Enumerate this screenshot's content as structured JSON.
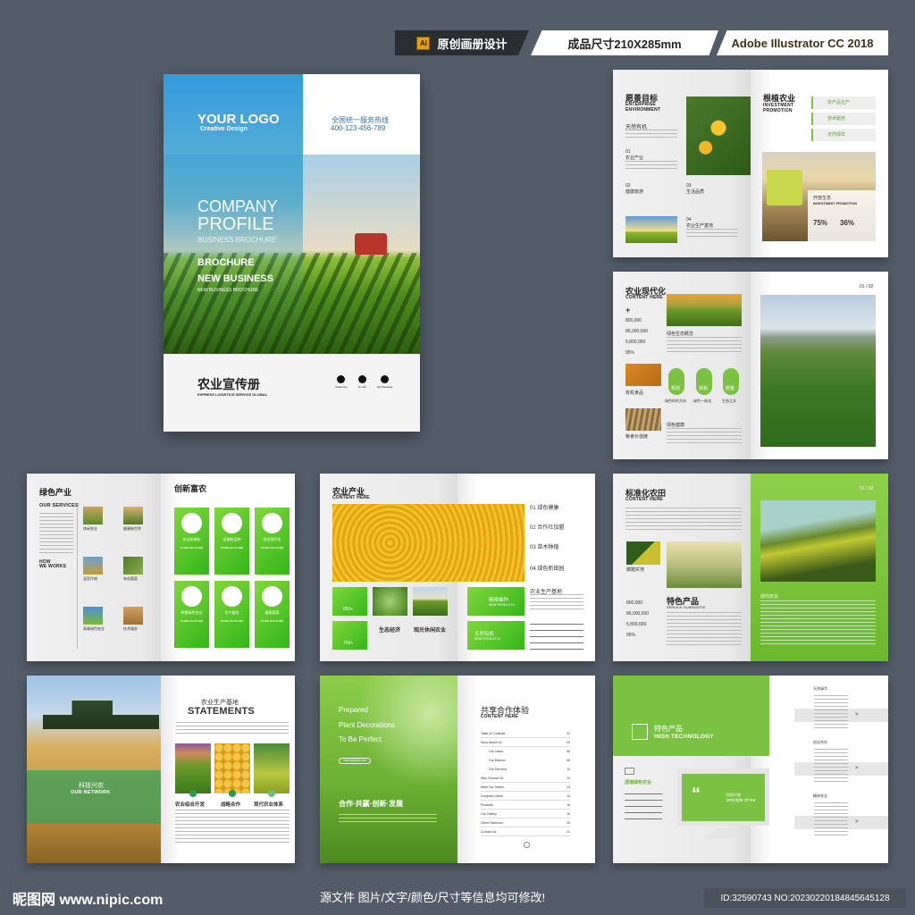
{
  "header": {
    "ai_icon": "Ai",
    "badge_original": "原创画册设计",
    "badge_size": "成品尺寸210X285mm",
    "badge_software": "Adobe Illustrator CC 2018"
  },
  "cover": {
    "logo": "YOUR LOGO",
    "logo_sub": "Creative Design",
    "hotline_label": "全国统一服务热线",
    "hotline": "400-123-456-789",
    "title1": "COMPANY",
    "title2": "PROFILE",
    "subtitle": "BUSINESS BROCHURE",
    "line1": "BROCHURE",
    "line2": "NEW BUSINESS",
    "line3": "NEW BUSINESS BROCHURE",
    "cn_title": "农业宣传册",
    "cn_sub": "EXPRESS LOGISTICS SERVICE GLOBAL",
    "contacts": [
      {
        "label": "Telephone"
      },
      {
        "label": "E-mail"
      },
      {
        "label": "QQ Message"
      }
    ]
  },
  "spread_vision": {
    "title": "愿景目标",
    "en1": "ENTERPRISE",
    "en2": "ENVIRONMENT",
    "organic": "天然有机",
    "items": [
      {
        "num": "01",
        "label": "农业产业"
      },
      {
        "num": "02",
        "label": "健康旅游"
      },
      {
        "num": "03",
        "label": "生活品质"
      },
      {
        "num": "04",
        "label": "农业生产基地"
      }
    ],
    "right_title": "根植农业",
    "right_en1": "INVESTMENT",
    "right_en2": "PROMOTION",
    "list": [
      "农产品生产",
      "技术服务",
      "天然绿华"
    ],
    "overlay_title": "开放生态",
    "overlay_en": "INVESTMENT PROMOTION",
    "stat1": "75%",
    "stat2": "36%"
  },
  "spread_modern": {
    "title": "农业现代化",
    "en": "CONTENT HERE",
    "plus": "+",
    "stats": [
      "800,000",
      "86,000,000",
      "5,800,000",
      "95%"
    ],
    "section1": "绿色生态概念",
    "circles": [
      "规划",
      "目标",
      "愿景"
    ],
    "circle_captions": [
      "绿色的的方向",
      "绿色一体化",
      "生态之本"
    ],
    "section2": "绿色健康",
    "photo_captions": [
      "有机食品",
      "粮食价值链"
    ],
    "page": "01 / 02"
  },
  "spread_green": {
    "title": "绿色产业",
    "en": "OUR SERVICES",
    "how1": "HOW",
    "how2": "WE WORKS",
    "services": [
      "休闲农业",
      "健康新世界",
      "温室作物",
      "有机蔬菜",
      "高端绿色农业",
      "技术服务"
    ],
    "right_title": "创新富农",
    "cards": [
      "农业机械化",
      "培育新品种",
      "农业现代化",
      "种植绿色农业",
      "生产服务",
      "健康蔬菜"
    ],
    "card_en": "TEAM CULTURE"
  },
  "spread_industry": {
    "title": "农业产业",
    "en": "CONTENT HERE",
    "list": [
      "01  绿色健康",
      "02  合作社加盟",
      "03  苗木种植",
      "04  绿色新田园"
    ],
    "count1": "850+",
    "count2": "760+",
    "eco": "生态经济",
    "tour": "观光休闲农业",
    "box1": "精耕细作",
    "box2": "天然有机",
    "box_en": "NEW PRODUCTS",
    "base": "农业生产基地"
  },
  "spread_standard": {
    "title": "标准化农田",
    "en": "CONTENT HERE",
    "photo_caption": "脚踏实地",
    "stats": [
      "800,000",
      "86,000,000",
      "5,800,000",
      "95%"
    ],
    "feature": "特色产品",
    "feature_en": "SERVICE GUARANTEE",
    "page": "01 / 02",
    "right_caption": "现代农业"
  },
  "spread_statements": {
    "left_cn": "科技兴农",
    "left_en": "OUR NETWORK",
    "title_cn": "农业生产基地",
    "title_en": "STATEMENTS",
    "cols": [
      "农业综合开发",
      "战略合作",
      "现代农业体系"
    ]
  },
  "spread_contents": {
    "l1": "Prepared",
    "l2": "Plant Decorations",
    "l3": "To Be Perfect",
    "btn": "WWW.WEBSITE.COM",
    "slogan": "合作·共赢·创新·发展",
    "title": "共享合作体验",
    "en": "CONTENT HERE",
    "toc": [
      {
        "label": "Table of Contents",
        "page": "02",
        "sub": false
      },
      {
        "label": "Story About Us",
        "page": "04",
        "sub": false
      },
      {
        "label": "Our Vision",
        "page": "06",
        "sub": true
      },
      {
        "label": "Our Mission",
        "page": "08",
        "sub": true
      },
      {
        "label": "Our Services",
        "page": "10",
        "sub": true
      },
      {
        "label": "Why Choose Us",
        "page": "12",
        "sub": false
      },
      {
        "label": "Meet Our Teams",
        "page": "13",
        "sub": false
      },
      {
        "label": "Company Value",
        "page": "14",
        "sub": false
      },
      {
        "label": "Products",
        "page": "16",
        "sub": false
      },
      {
        "label": "Our Gallery",
        "page": "18",
        "sub": false
      },
      {
        "label": "Client Testimoni",
        "page": "20",
        "sub": false
      },
      {
        "label": "Contact Us",
        "page": "21",
        "sub": false
      }
    ]
  },
  "spread_tech": {
    "title_cn": "特色产品",
    "title_en": "HIGH TECHNOLOGY",
    "sub": "透墙绿色农业",
    "screen_cn": "科技兴农",
    "screen_en": "principle of our",
    "quote": "“",
    "right_items": [
      "天然绿华",
      "创业合作",
      "精致农业"
    ],
    "arrow": ">"
  },
  "footer": {
    "logo": "昵图网 www.nipic.com",
    "notice": "源文件 图片/文字/颜色/尺寸等信息均可修改!",
    "id": "ID:32590743 NO:20230220184845645128"
  },
  "colors": {
    "bg": "#535d69",
    "green": "#7cc242",
    "bright_green": "#3cbc1c",
    "blue": "#2f9fe0"
  }
}
